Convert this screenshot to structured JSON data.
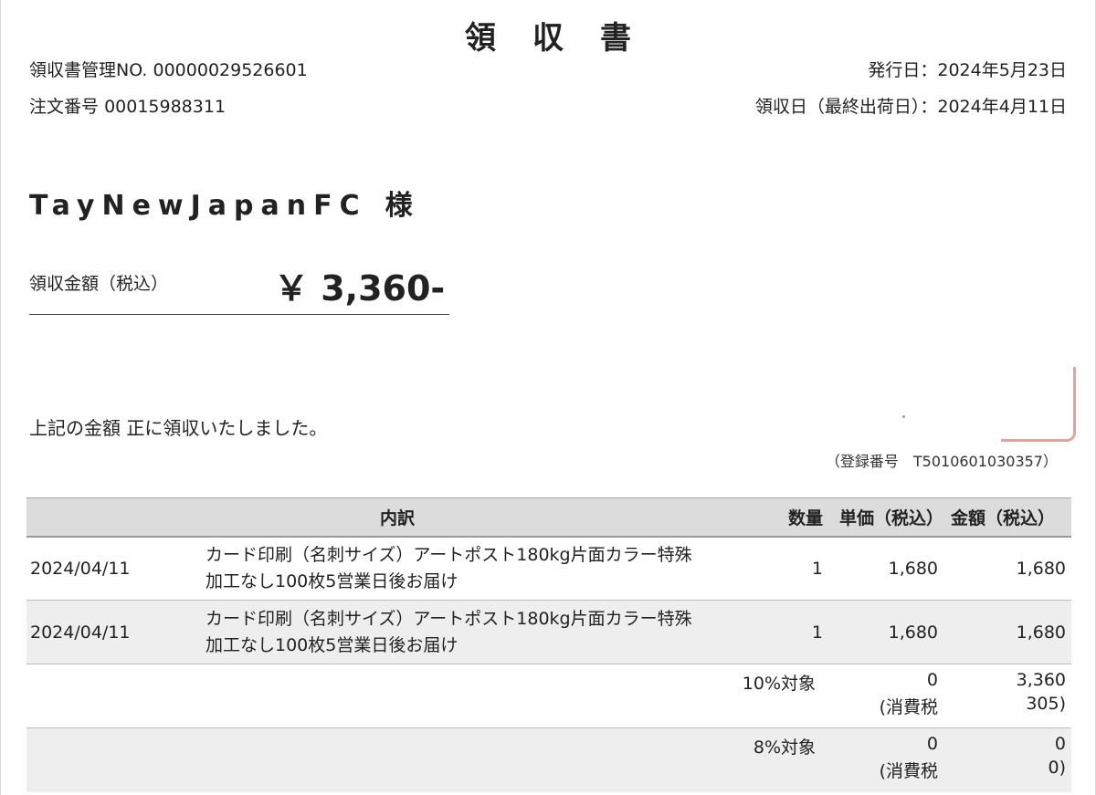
{
  "document": {
    "title": "領収書",
    "management_no_label": "領収書管理NO.",
    "management_no": "00000029526601",
    "order_no_label": "注文番号",
    "order_no": "00015988311",
    "issue_date_label": "発行日：",
    "issue_date": "2024年5月23日",
    "receipt_date_label": "領収日（最終出荷日）：",
    "receipt_date": "2024年4月11日"
  },
  "customer": {
    "name": "TayNewJapanFC",
    "suffix": "様"
  },
  "amount": {
    "label": "領収金額（税込）",
    "value": "￥ 3,360-"
  },
  "received_statement": "上記の金額 正に領収いたしました。",
  "registration": {
    "text": "（登録番号　T5010601030357）"
  },
  "colors": {
    "header_bg": "#dcdcdc",
    "alt_row_bg": "#eeeeee",
    "stamp": "#e3a29c"
  },
  "table": {
    "headers": {
      "breakdown": "内訳",
      "quantity": "数量",
      "unit_price": "単価（税込）",
      "amount": "金額（税込）"
    },
    "rows": [
      {
        "date": "2024/04/11",
        "description_line1": "カード印刷（名刺サイズ）アートポスト180kg片面カラー特殊",
        "description_line2": "加工なし100枚5営業日後お届け",
        "quantity": "1",
        "unit_price": "1,680",
        "amount": "1,680"
      },
      {
        "date": "2024/04/11",
        "description_line1": "カード印刷（名刺サイズ）アートポスト180kg片面カラー特殊",
        "description_line2": "加工なし100枚5営業日後お届け",
        "quantity": "1",
        "unit_price": "1,680",
        "amount": "1,680"
      }
    ],
    "tax_rows": [
      {
        "label": "10%対象",
        "unit_line1": "0",
        "unit_line2": "(消費税",
        "amount_line1": "3,360",
        "amount_line2": "305)"
      },
      {
        "label": "8%対象",
        "unit_line1": "0",
        "unit_line2": "(消費税",
        "amount_line1": "0",
        "amount_line2": "0)"
      }
    ]
  }
}
